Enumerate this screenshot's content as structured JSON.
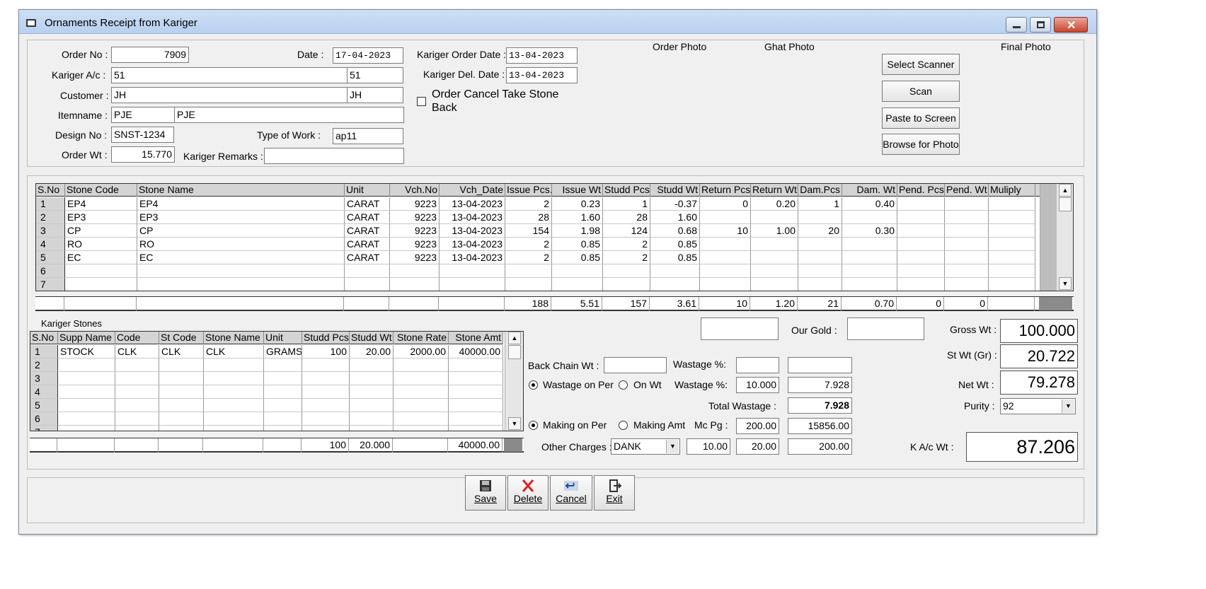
{
  "window": {
    "title": "Ornaments Receipt from Kariger"
  },
  "header": {
    "order_no_label": "Order No :",
    "order_no": "7909",
    "date_label": "Date :",
    "date": "17-04-2023",
    "kariger_ac_label": "Kariger A/c :",
    "kariger_ac_code": "51",
    "kariger_ac_name": "51",
    "customer_label": "Customer :",
    "customer_code": "JH",
    "customer_name": "JH",
    "itemname_label": "Itemname :",
    "itemname_code": "PJE",
    "itemname_name": "PJE",
    "design_no_label": "Design No :",
    "design_no": "SNST-1234",
    "type_of_work_label": "Type of Work :",
    "type_of_work": "ap11",
    "order_wt_label": "Order Wt :",
    "order_wt": "15.770",
    "kariger_remarks_label": "Kariger Remarks :",
    "kariger_remarks": "",
    "kariger_order_date_label": "Kariger Order Date :",
    "kariger_order_date": "13-04-2023",
    "kariger_del_date_label": "Kariger Del. Date :",
    "kariger_del_date": "13-04-2023",
    "order_cancel_label_1": "Order Cancel Take Stone",
    "order_cancel_label_2": "Back",
    "order_photo_label": "Order Photo",
    "ghat_photo_label": "Ghat Photo",
    "final_photo_label": "Final Photo",
    "select_scanner": "Select Scanner",
    "scan": "Scan",
    "paste_to_screen": "Paste to Screen",
    "browse_for_photo": "Browse for Photo"
  },
  "stones": {
    "columns": [
      "S.No",
      "Stone Code",
      "Stone Name",
      "Unit",
      "Vch.No",
      "Vch_Date",
      "Issue Pcs.",
      "Issue Wt",
      "Studd Pcs",
      "Studd Wt",
      "Return Pcs",
      "Return Wt",
      "Dam.Pcs",
      "Dam. Wt",
      "Pend. Pcs",
      "Pend. Wt",
      "Muliply"
    ],
    "rows": [
      [
        "1",
        "EP4",
        "EP4",
        "CARAT",
        "9223",
        "13-04-2023",
        "2",
        "0.23",
        "1",
        "-0.37",
        "0",
        "0.20",
        "1",
        "0.40",
        "",
        "",
        ""
      ],
      [
        "2",
        "EP3",
        "EP3",
        "CARAT",
        "9223",
        "13-04-2023",
        "28",
        "1.60",
        "28",
        "1.60",
        "",
        "",
        "",
        "",
        "",
        "",
        ""
      ],
      [
        "3",
        "CP",
        "CP",
        "CARAT",
        "9223",
        "13-04-2023",
        "154",
        "1.98",
        "124",
        "0.68",
        "10",
        "1.00",
        "20",
        "0.30",
        "",
        "",
        ""
      ],
      [
        "4",
        "RO",
        "RO",
        "CARAT",
        "9223",
        "13-04-2023",
        "2",
        "0.85",
        "2",
        "0.85",
        "",
        "",
        "",
        "",
        "",
        "",
        ""
      ],
      [
        "5",
        "EC",
        "EC",
        "CARAT",
        "9223",
        "13-04-2023",
        "2",
        "0.85",
        "2",
        "0.85",
        "",
        "",
        "",
        "",
        "",
        "",
        ""
      ],
      [
        "6",
        "",
        "",
        "",
        "",
        "",
        "",
        "",
        "",
        "",
        "",
        "",
        "",
        "",
        "",
        "",
        ""
      ],
      [
        "7",
        "",
        "",
        "",
        "",
        "",
        "",
        "",
        "",
        "",
        "",
        "",
        "",
        "",
        "",
        "",
        ""
      ]
    ],
    "totals": [
      "",
      "",
      "",
      "",
      "",
      "",
      "188",
      "5.51",
      "157",
      "3.61",
      "10",
      "1.20",
      "21",
      "0.70",
      "0",
      "0",
      ""
    ]
  },
  "kariger_stones": {
    "title": "Kariger Stones",
    "columns": [
      "S.No",
      "Supp Name",
      "Code",
      "St Code",
      "Stone Name",
      "Unit",
      "Studd Pcs",
      "Studd Wt",
      "Stone Rate",
      "Stone Amt"
    ],
    "rows": [
      [
        "1",
        "STOCK",
        "CLK",
        "CLK",
        "CLK",
        "GRAMS",
        "100",
        "20.00",
        "2000.00",
        "40000.00"
      ],
      [
        "2",
        "",
        "",
        "",
        "",
        "",
        "",
        "",
        "",
        ""
      ],
      [
        "3",
        "",
        "",
        "",
        "",
        "",
        "",
        "",
        "",
        ""
      ],
      [
        "4",
        "",
        "",
        "",
        "",
        "",
        "",
        "",
        "",
        ""
      ],
      [
        "5",
        "",
        "",
        "",
        "",
        "",
        "",
        "",
        "",
        ""
      ],
      [
        "6",
        "",
        "",
        "",
        "",
        "",
        "",
        "",
        "",
        ""
      ],
      [
        "7",
        "",
        "",
        "",
        "",
        "",
        "",
        "",
        "",
        ""
      ]
    ],
    "totals": [
      "",
      "",
      "",
      "",
      "",
      "",
      "100",
      "20.000",
      "",
      "40000.00"
    ]
  },
  "calc": {
    "our_gold_label": "Our Gold :",
    "our_gold_left": "",
    "our_gold": "",
    "back_chain_label": "Back Chain Wt :",
    "back_chain_wt": "",
    "wastage_pct_label": "Wastage %:",
    "wastage_pct_1": "",
    "wastage_val_1": "",
    "wastage_on_per": "Wastage on Per",
    "on_wt": "On Wt",
    "wastage_pct_label_2": "Wastage %:",
    "wastage_pct": "10.000",
    "wastage_val": "7.928",
    "total_wastage_label": "Total Wastage :",
    "total_wastage": "7.928",
    "making_on_per": "Making on Per",
    "making_amt": "Making Amt",
    "mc_pg_label": "Mc Pg :",
    "mc_pg": "200.00",
    "mc_amt": "15856.00",
    "other_charges_label": "Other Charges :",
    "other_charges_type": "DANK",
    "other_1": "10.00",
    "other_2": "20.00",
    "other_3": "200.00",
    "gross_wt_label": "Gross Wt :",
    "gross_wt": "100.000",
    "st_wt_label": "St Wt (Gr) :",
    "st_wt": "20.722",
    "net_wt_label": "Net Wt :",
    "net_wt": "79.278",
    "purity_label": "Purity :",
    "purity": "92",
    "ka_wt_label": "K A/c Wt :",
    "ka_wt": "87.206"
  },
  "actions": {
    "save": "Save",
    "delete": "Delete",
    "cancel": "Cancel",
    "exit": "Exit"
  }
}
